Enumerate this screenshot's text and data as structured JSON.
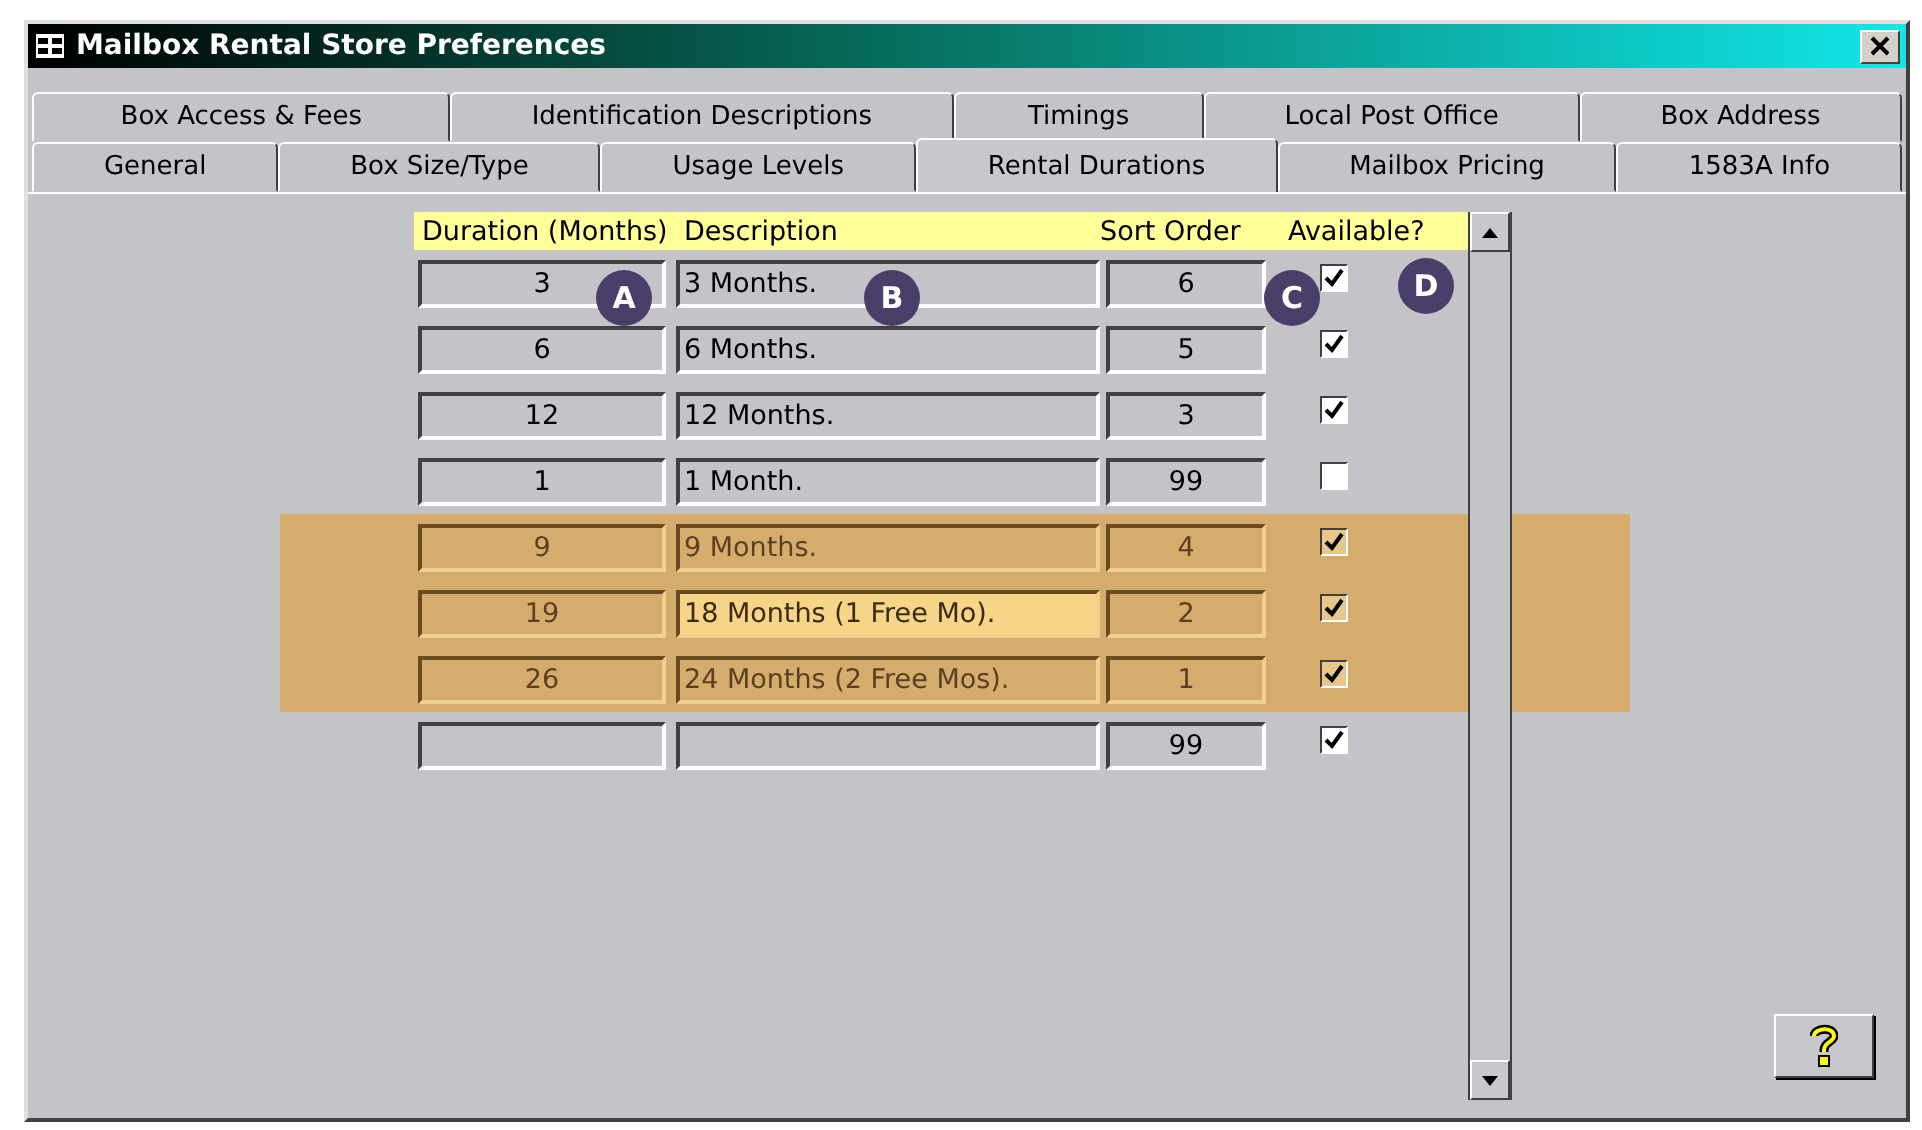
{
  "window": {
    "title": "Mailbox Rental Store Preferences"
  },
  "tab_rows": [
    [
      {
        "label": "Box Access & Fees",
        "selected": false
      },
      {
        "label": "Identification Descriptions",
        "selected": false
      },
      {
        "label": "Timings",
        "selected": false
      },
      {
        "label": "Local Post Office",
        "selected": false
      },
      {
        "label": "Box Address",
        "selected": false
      }
    ],
    [
      {
        "label": "General",
        "selected": false
      },
      {
        "label": "Box Size/Type",
        "selected": false
      },
      {
        "label": "Usage Levels",
        "selected": false
      },
      {
        "label": "Rental Durations",
        "selected": true
      },
      {
        "label": "Mailbox Pricing",
        "selected": false
      },
      {
        "label": "1583A Info",
        "selected": false
      }
    ]
  ],
  "columns": [
    "Duration (Months)",
    "Description",
    "Sort Order",
    "Available?"
  ],
  "rows": [
    {
      "duration": "3",
      "description": "3 Months.",
      "sort_order": "6",
      "available": true,
      "highlighted": false,
      "focused": false
    },
    {
      "duration": "6",
      "description": "6 Months.",
      "sort_order": "5",
      "available": true,
      "highlighted": false,
      "focused": false
    },
    {
      "duration": "12",
      "description": "12 Months.",
      "sort_order": "3",
      "available": true,
      "highlighted": false,
      "focused": false
    },
    {
      "duration": "1",
      "description": "1 Month.",
      "sort_order": "99",
      "available": false,
      "highlighted": false,
      "focused": false
    },
    {
      "duration": "9",
      "description": "9 Months.",
      "sort_order": "4",
      "available": true,
      "highlighted": true,
      "focused": false
    },
    {
      "duration": "19",
      "description": "18 Months (1 Free Mo).",
      "sort_order": "2",
      "available": true,
      "highlighted": true,
      "focused": true
    },
    {
      "duration": "26",
      "description": "24 Months (2 Free Mos).",
      "sort_order": "1",
      "available": true,
      "highlighted": true,
      "focused": false
    },
    {
      "sort_order": "99",
      "available": true,
      "highlighted": false,
      "focused": false
    }
  ],
  "callouts": [
    "A",
    "B",
    "C",
    "D"
  ]
}
